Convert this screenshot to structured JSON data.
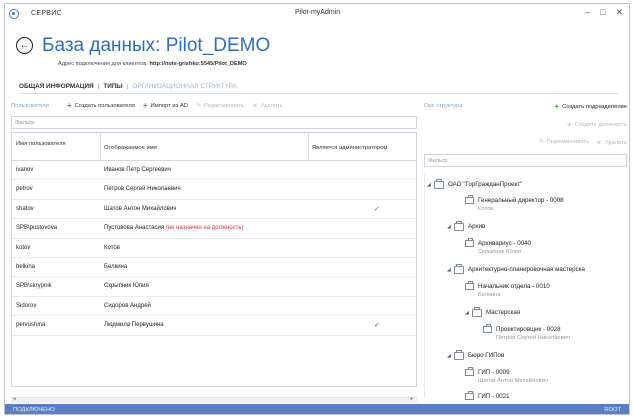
{
  "titlebar": {
    "menu": "СЕРВИС",
    "title": "Pilot-myAdmin"
  },
  "header": {
    "title": "База данных: Pilot_DEMO",
    "address_label": "Адрес подключения для клиентов:",
    "address_value": "http://note-grishko:5545/Pilot_DEMO"
  },
  "tabs": [
    {
      "label": "ОБЩАЯ ИНФОРМАЦИЯ",
      "active": true
    },
    {
      "label": "ТИПЫ",
      "active": true
    },
    {
      "label": "ОРГАНИЗАЦИОННАЯ СТРУКТУРА",
      "active": false
    }
  ],
  "users": {
    "title": "Пользователи",
    "create": "Создать пользователя",
    "import": "Импорт из AD",
    "edit": "Редактировать",
    "delete": "Удалить",
    "filter_placeholder": "Фильтр",
    "columns": [
      "Имя пользователя",
      "Отображаемое имя",
      "Является администратором"
    ],
    "rows": [
      {
        "login": "ivanov",
        "name": "Иванов Петр Сергеевич",
        "note": "",
        "admin": ""
      },
      {
        "login": "petrov",
        "name": "Петров Сергей Николаевич",
        "note": "",
        "admin": ""
      },
      {
        "login": "shatov",
        "name": "Шатов Антон Михайлович",
        "note": "",
        "admin": "✓"
      },
      {
        "login": "SPB\\pustovova",
        "name": "Пустовова Анастасия",
        "note": "(не назначен на должность)",
        "admin": ""
      },
      {
        "login": "kotov",
        "name": "Котов",
        "note": "",
        "admin": ""
      },
      {
        "login": "belkina",
        "name": "Белкина",
        "note": "",
        "admin": ""
      },
      {
        "login": "SPB\\skrypnik",
        "name": "Скрыпник Юлия",
        "note": "",
        "admin": ""
      },
      {
        "login": "Sidorov",
        "name": "Сидоров Андрей",
        "note": "",
        "admin": ""
      },
      {
        "login": "pervushina",
        "name": "Людмила Первушина",
        "note": "",
        "admin": "✓"
      }
    ]
  },
  "org": {
    "title": "Орг. структура",
    "create_dept": "Создать подразделение",
    "create_pos": "Создать должность",
    "rename": "Переименовать",
    "delete": "Удалить",
    "filter_placeholder": "Фильтр",
    "tree": [
      {
        "label": "ОАО \"ГорГражданПроект\"",
        "sub": ""
      },
      {
        "label": "Генеральный директор - 0008",
        "sub": "Котов"
      },
      {
        "label": "Архив",
        "sub": ""
      },
      {
        "label": "Архивариус - 0040",
        "sub": "Скрыпник Юлия"
      },
      {
        "label": "Архитектурно-планировочная мастерска",
        "sub": ""
      },
      {
        "label": "Начальник отдела - 0010",
        "sub": "Белкина"
      },
      {
        "label": "Мастерская",
        "sub": ""
      },
      {
        "label": "Проектировщик - 0028",
        "sub": "Петров Сергей Николаевич"
      },
      {
        "label": "Бюро ГИПов",
        "sub": ""
      },
      {
        "label": "ГИП - 0009",
        "sub": "Шатов Антон Михайлович"
      },
      {
        "label": "ГИП - 0021",
        "sub": ""
      }
    ]
  },
  "status": {
    "left": "ПОДКЛЮЧЕНО",
    "right": "ROOT"
  }
}
